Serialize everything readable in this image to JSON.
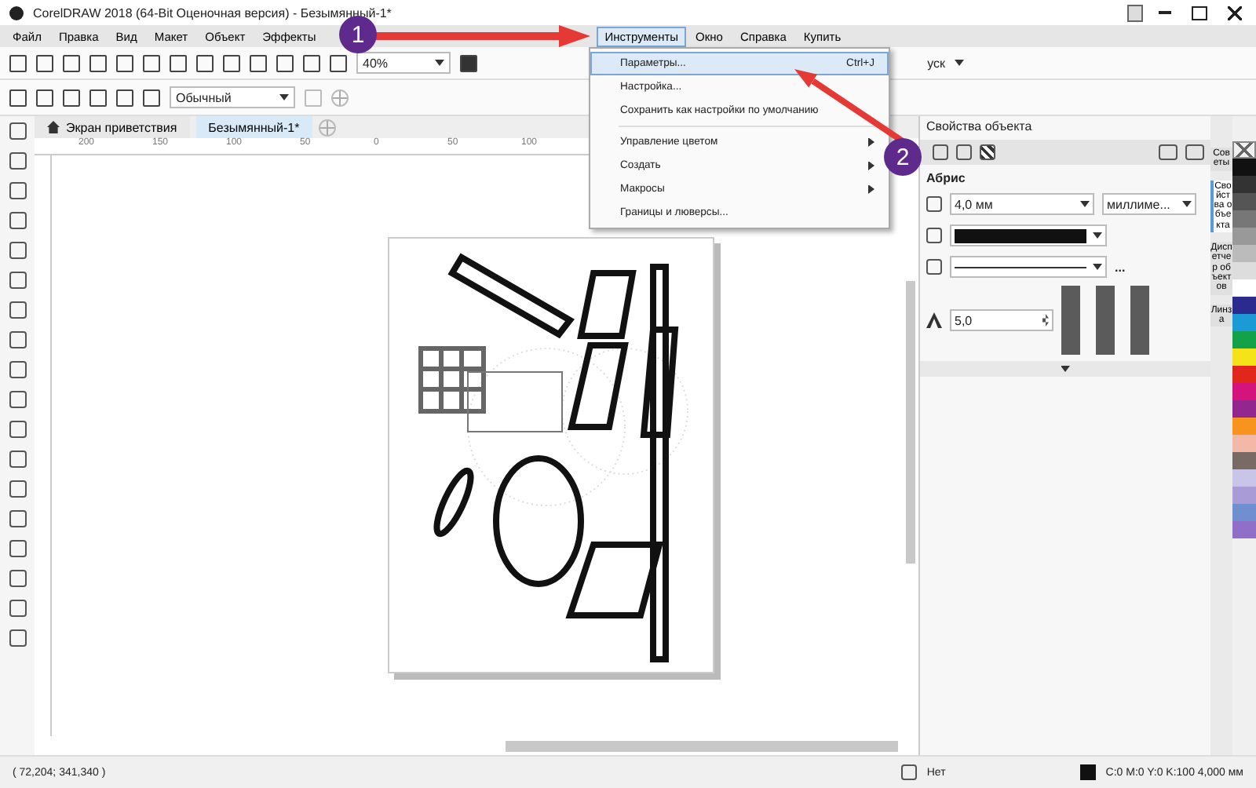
{
  "window": {
    "title": "CorelDRAW 2018 (64-Bit Оценочная версия) - Безымянный-1*"
  },
  "menu_bar": [
    {
      "label": "Файл",
      "selected": false
    },
    {
      "label": "Правка",
      "selected": false
    },
    {
      "label": "Вид",
      "selected": false
    },
    {
      "label": "Макет",
      "selected": false
    },
    {
      "label": "Объект",
      "selected": false
    },
    {
      "label": "Эффекты",
      "selected": false
    },
    {
      "label": "Инструменты",
      "selected": true
    },
    {
      "label": "Окно",
      "selected": false
    },
    {
      "label": "Справка",
      "selected": false
    },
    {
      "label": "Купить",
      "selected": false
    }
  ],
  "toolbar": {
    "zoom": "40%",
    "partial_label": "уск"
  },
  "property_bar": {
    "style": "Обычный"
  },
  "document_tabs": [
    {
      "label": "Экран приветствия",
      "selected": false
    },
    {
      "label": "Безымянный-1*",
      "selected": true
    }
  ],
  "ruler_labels": [
    "200",
    "150",
    "100",
    "50",
    "0",
    "50",
    "100"
  ],
  "tools_menu": [
    {
      "kind": "item",
      "label": "Параметры...",
      "shortcut": "Ctrl+J",
      "selected": true
    },
    {
      "kind": "item",
      "label": "Настройка...",
      "selected": false
    },
    {
      "kind": "item",
      "label": "Сохранить как настройки по умолчанию",
      "selected": false
    },
    {
      "kind": "submenu",
      "label": "Управление цветом",
      "selected": false
    },
    {
      "kind": "submenu",
      "label": "Создать",
      "selected": false
    },
    {
      "kind": "submenu",
      "label": "Макросы",
      "selected": false
    },
    {
      "kind": "item",
      "label": "Границы и люверсы...",
      "selected": false
    }
  ],
  "annotations": [
    "1",
    "2"
  ],
  "object_properties": {
    "title": "Свойства объекта",
    "section": "Абрис",
    "width": "4,0 мм",
    "units": "миллиме...",
    "more": "...",
    "miter_limit": "5,0"
  },
  "side_tabs": [
    {
      "label": "Советы",
      "selected": false
    },
    {
      "label": "Свойства объекта",
      "selected": true
    },
    {
      "label": "Диспетчер объектов",
      "selected": false
    },
    {
      "label": "Линза",
      "selected": false
    }
  ],
  "palette": [
    {
      "color": "#111111"
    },
    {
      "color": "#333333"
    },
    {
      "color": "#555555"
    },
    {
      "color": "#777777"
    },
    {
      "color": "#999999"
    },
    {
      "color": "#bbbbbb"
    },
    {
      "color": "#dddddd"
    },
    {
      "color": "#ffffff"
    },
    {
      "color": "#2b2a8f"
    },
    {
      "color": "#1b9ad6"
    },
    {
      "color": "#13a14a"
    },
    {
      "color": "#f5e31a"
    },
    {
      "color": "#e1261c"
    },
    {
      "color": "#d4147a"
    },
    {
      "color": "#93278f"
    },
    {
      "color": "#f7941d"
    },
    {
      "color": "#f4b8a8"
    },
    {
      "color": "#7a6a66"
    },
    {
      "color": "#c9c5e8"
    },
    {
      "color": "#a99bd6"
    },
    {
      "color": "#6f8fd0"
    },
    {
      "color": "#8f6fc8"
    }
  ],
  "status_bar": {
    "coordinates": "( 72,204; 341,340 )",
    "fill": "Нет",
    "outline": "C:0 M:0 Y:0 K:100  4,000 мм"
  }
}
